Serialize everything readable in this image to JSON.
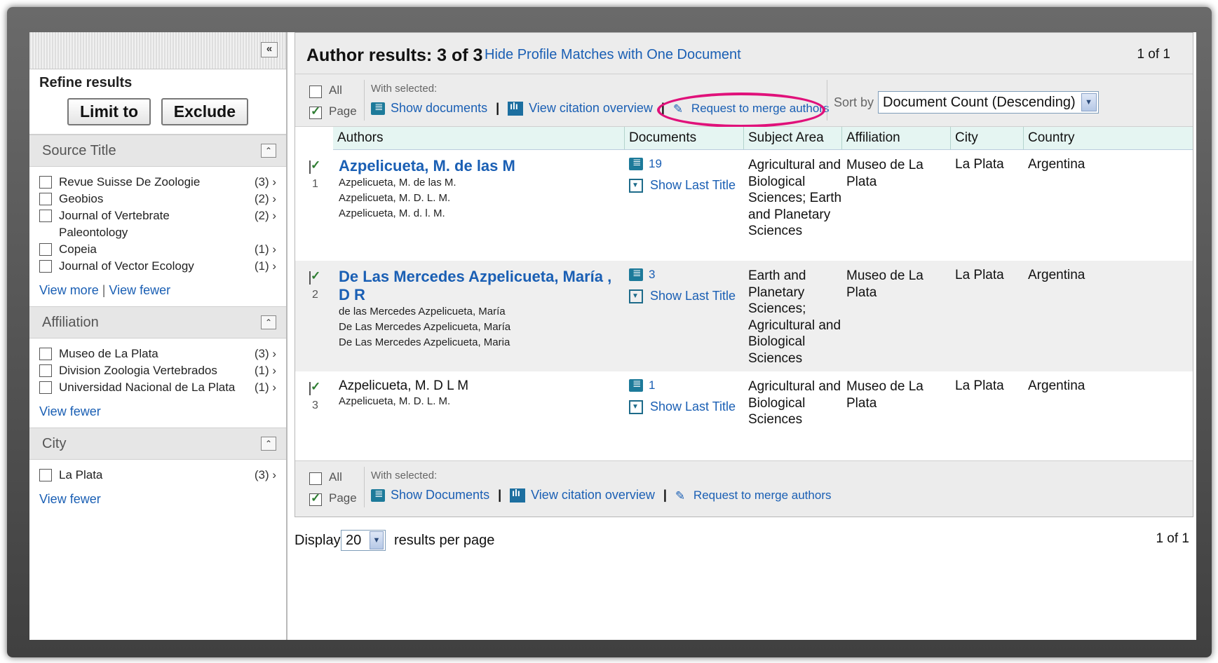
{
  "sidebar": {
    "collapse_icon": "«",
    "refine_title": "Refine results",
    "limit_label": "Limit to",
    "exclude_label": "Exclude",
    "facets": [
      {
        "title": "Source Title",
        "toggle_icon": "⌃",
        "items": [
          {
            "label": "Revue Suisse De Zoologie",
            "count": "(3)"
          },
          {
            "label": "Geobios",
            "count": "(2)"
          },
          {
            "label": "Journal of Vertebrate Paleontology",
            "count": "(2)"
          },
          {
            "label": "Copeia",
            "count": "(1)"
          },
          {
            "label": "Journal of Vector Ecology",
            "count": "(1)"
          }
        ],
        "link_more": "View more",
        "link_fewer": "View fewer"
      },
      {
        "title": "Affiliation",
        "toggle_icon": "⌃",
        "items": [
          {
            "label": "Museo de La Plata",
            "count": "(3)"
          },
          {
            "label": "Division Zoologia Vertebrados",
            "count": "(1)"
          },
          {
            "label": "Universidad Nacional de La Plata",
            "count": "(1)"
          }
        ],
        "link_fewer": "View fewer"
      },
      {
        "title": "City",
        "toggle_icon": "⌃",
        "items": [
          {
            "label": "La Plata",
            "count": "(3)"
          }
        ],
        "link_fewer": "View fewer"
      }
    ]
  },
  "main": {
    "title": "Author results: 3 of 3",
    "hide_link": "Hide Profile Matches with One Document",
    "paging": "1  of 1",
    "toolbar": {
      "all_label": "All",
      "page_label": "Page",
      "with_selected": "With selected:",
      "show_documents": "Show documents",
      "view_citation": "View citation overview",
      "merge_authors": "Request to merge authors",
      "sort_by_label": "Sort by",
      "sort_value": "Document Count (Descending)"
    },
    "columns": [
      "Authors",
      "Documents",
      "Subject Area",
      "Affiliation",
      "City",
      "Country"
    ],
    "rows": [
      {
        "num": "1",
        "name": "Azpelicueta, M. de las M",
        "variants": [
          "Azpelicueta, M. de las M.",
          "Azpelicueta, M. D. L. M.",
          "Azpelicueta, M. d. l. M."
        ],
        "docs": "19",
        "last_title": "Show Last Title",
        "subject": "Agricultural and Biological Sciences; Earth and Planetary Sciences",
        "affiliation": "Museo de La Plata",
        "city": "La Plata",
        "country": "Argentina"
      },
      {
        "num": "2",
        "name": "De Las Mercedes Azpelicueta, María , D R",
        "variants": [
          "de las Mercedes Azpelicueta, María",
          "De Las Mercedes Azpelicueta, María",
          "De Las Mercedes Azpelicueta, Maria"
        ],
        "docs": "3",
        "last_title": "Show Last Title",
        "subject": "Earth and Planetary Sciences; Agricultural and Biological Sciences",
        "affiliation": "Museo de La Plata",
        "city": "La Plata",
        "country": "Argentina"
      },
      {
        "num": "3",
        "name": "Azpelicueta, M. D L M",
        "variants": [
          "Azpelicueta, M. D. L. M."
        ],
        "docs": "1",
        "last_title": "Show Last Title",
        "subject": "Agricultural and Biological Sciences",
        "affiliation": "Museo de La Plata",
        "city": "La Plata",
        "country": "Argentina"
      }
    ],
    "bottom_toolbar": {
      "all_label": "All",
      "page_label": "Page",
      "with_selected": "With selected:",
      "show_documents": "Show Documents",
      "view_citation": "View citation overview",
      "merge_authors": "Request to merge authors"
    },
    "display": {
      "label": "Display",
      "value": "20",
      "suffix": "results per page",
      "paging": "1  of 1"
    }
  },
  "colors": {
    "link": "#1a5fb4",
    "highlight": "#e0117a",
    "header_bg": "#e5f5f2"
  }
}
